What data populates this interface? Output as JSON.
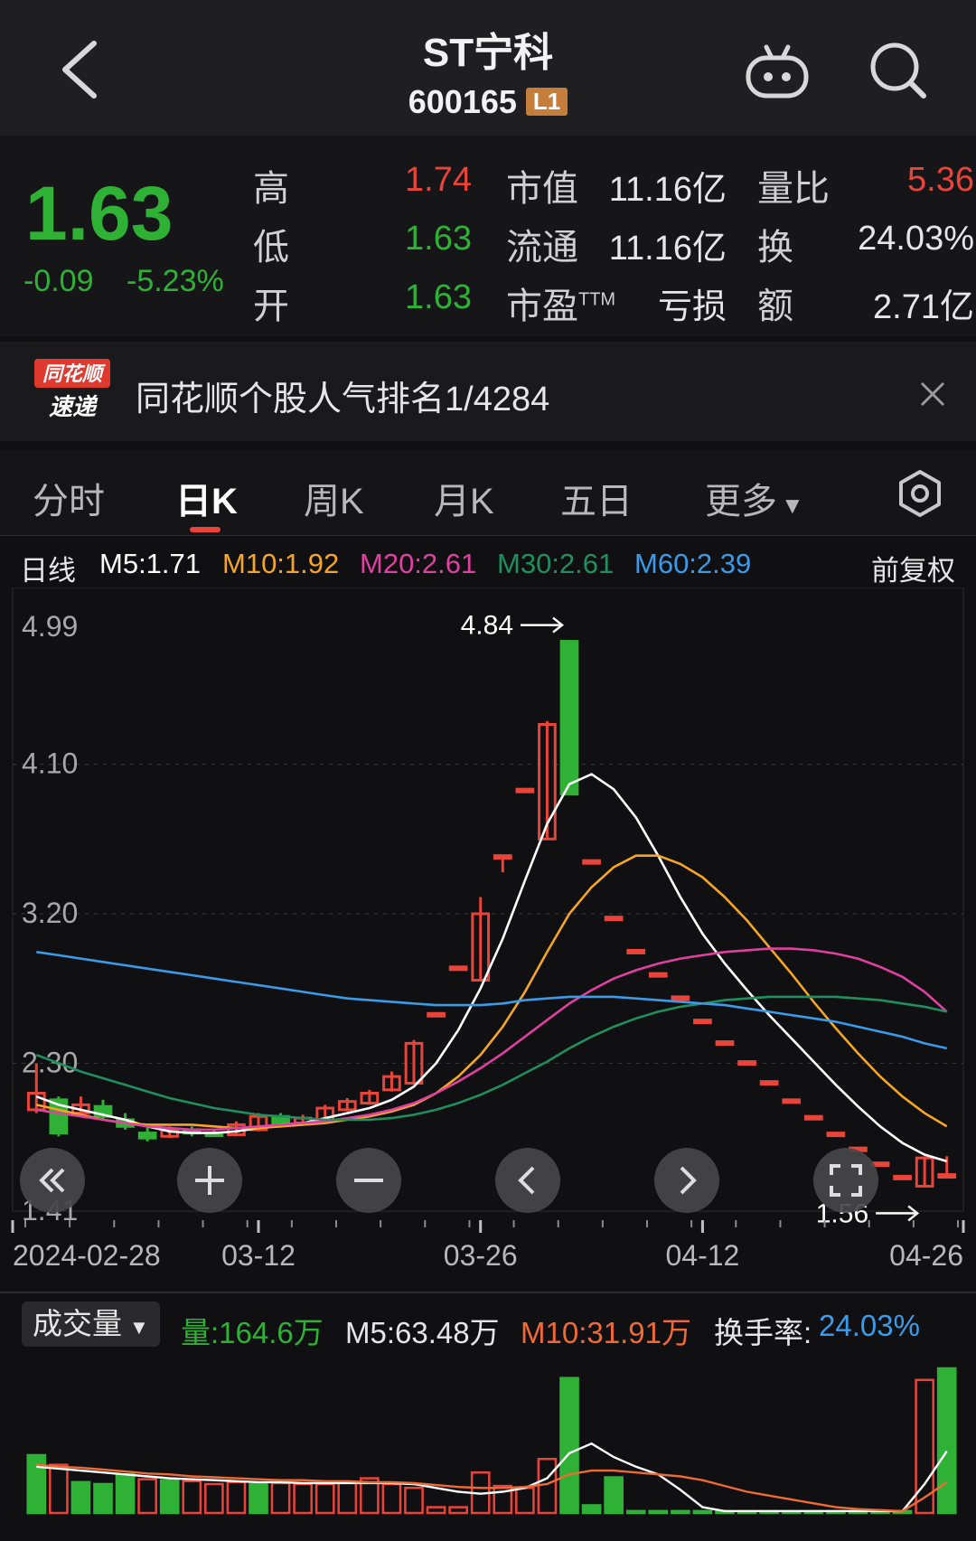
{
  "header": {
    "title": "ST宁科",
    "code": "600165",
    "level": "L1"
  },
  "quote": {
    "price": "1.63",
    "change": "-0.09",
    "change_pct": "-5.23%",
    "high_label": "高",
    "high": "1.74",
    "low_label": "低",
    "low": "1.63",
    "open_label": "开",
    "open": "1.63",
    "mcap_label": "市值",
    "mcap": "11.16亿",
    "float_label": "流通",
    "float": "11.16亿",
    "pe_label": "市盈",
    "pe_sup": "TTM",
    "pe": "亏损",
    "vol_ratio_label": "量比",
    "vol_ratio": "5.36",
    "turnover_label": "换",
    "turnover": "24.03%",
    "amount_label": "额",
    "amount": "2.71亿"
  },
  "banner": {
    "logo_top": "同花顺",
    "logo_bottom": "速递",
    "text": "同花顺个股人气排名1/4284"
  },
  "tabs": [
    "分时",
    "日K",
    "周K",
    "月K",
    "五日",
    "更多"
  ],
  "ma_legend": {
    "period": "日线",
    "m5": "M5:1.71",
    "m10": "M10:1.92",
    "m20": "M20:2.61",
    "m30": "M30:2.61",
    "m60": "M60:2.39",
    "adjust": "前复权",
    "colors": {
      "m5": "#ffffff",
      "m10": "#f5a623",
      "m20": "#e040a0",
      "m30": "#1f8f5f",
      "m60": "#3a9be8"
    }
  },
  "chart_data": {
    "type": "candlestick",
    "y_ticks": [
      "4.99",
      "4.10",
      "3.20",
      "2.30",
      "1.41"
    ],
    "ylim": [
      1.41,
      4.99
    ],
    "x_ticks": [
      "2024-02-28",
      "03-12",
      "03-26",
      "04-12",
      "04-26"
    ],
    "max_label": "4.84",
    "min_label": "1.56",
    "candles": [
      {
        "o": 2.02,
        "c": 2.12,
        "h": 2.3,
        "l": 2.0
      },
      {
        "o": 2.08,
        "c": 1.88,
        "h": 2.1,
        "l": 1.86
      },
      {
        "o": 2.0,
        "c": 2.05,
        "h": 2.1,
        "l": 1.98
      },
      {
        "o": 2.04,
        "c": 1.98,
        "h": 2.08,
        "l": 1.96
      },
      {
        "o": 1.96,
        "c": 1.92,
        "h": 2.0,
        "l": 1.9
      },
      {
        "o": 1.88,
        "c": 1.85,
        "h": 1.92,
        "l": 1.83
      },
      {
        "o": 1.86,
        "c": 1.9,
        "h": 1.92,
        "l": 1.85
      },
      {
        "o": 1.9,
        "c": 1.88,
        "h": 1.92,
        "l": 1.86
      },
      {
        "o": 1.88,
        "c": 1.87,
        "h": 1.9,
        "l": 1.86
      },
      {
        "o": 1.87,
        "c": 1.93,
        "h": 1.95,
        "l": 1.86
      },
      {
        "o": 1.9,
        "c": 1.98,
        "h": 2.0,
        "l": 1.89
      },
      {
        "o": 1.98,
        "c": 1.94,
        "h": 2.0,
        "l": 1.93
      },
      {
        "o": 1.94,
        "c": 1.97,
        "h": 1.99,
        "l": 1.93
      },
      {
        "o": 1.96,
        "c": 2.03,
        "h": 2.05,
        "l": 1.95
      },
      {
        "o": 2.02,
        "c": 2.07,
        "h": 2.09,
        "l": 2.01
      },
      {
        "o": 2.06,
        "c": 2.12,
        "h": 2.14,
        "l": 2.05
      },
      {
        "o": 2.14,
        "c": 2.22,
        "h": 2.25,
        "l": 2.13
      },
      {
        "o": 2.18,
        "c": 2.42,
        "h": 2.44,
        "l": 2.17
      },
      {
        "o": 2.6,
        "c": 2.6,
        "h": 2.6,
        "l": 2.6
      },
      {
        "o": 2.88,
        "c": 2.88,
        "h": 2.88,
        "l": 2.88
      },
      {
        "o": 2.8,
        "c": 3.2,
        "h": 3.3,
        "l": 2.8
      },
      {
        "o": 3.55,
        "c": 3.55,
        "h": 3.55,
        "l": 3.45
      },
      {
        "o": 3.95,
        "c": 3.95,
        "h": 3.95,
        "l": 3.95
      },
      {
        "o": 3.65,
        "c": 4.34,
        "h": 4.36,
        "l": 3.65
      },
      {
        "o": 4.84,
        "c": 3.92,
        "h": 4.84,
        "l": 3.92
      },
      {
        "o": 3.52,
        "c": 3.52,
        "h": 3.52,
        "l": 3.52
      },
      {
        "o": 3.18,
        "c": 3.18,
        "h": 3.18,
        "l": 3.18
      },
      {
        "o": 2.98,
        "c": 2.98,
        "h": 2.98,
        "l": 2.98
      },
      {
        "o": 2.84,
        "c": 2.84,
        "h": 2.84,
        "l": 2.84
      },
      {
        "o": 2.7,
        "c": 2.7,
        "h": 2.7,
        "l": 2.7
      },
      {
        "o": 2.56,
        "c": 2.56,
        "h": 2.56,
        "l": 2.56
      },
      {
        "o": 2.43,
        "c": 2.43,
        "h": 2.43,
        "l": 2.43
      },
      {
        "o": 2.31,
        "c": 2.31,
        "h": 2.31,
        "l": 2.31
      },
      {
        "o": 2.19,
        "c": 2.19,
        "h": 2.19,
        "l": 2.19
      },
      {
        "o": 2.08,
        "c": 2.08,
        "h": 2.08,
        "l": 2.08
      },
      {
        "o": 1.98,
        "c": 1.98,
        "h": 1.98,
        "l": 1.98
      },
      {
        "o": 1.88,
        "c": 1.88,
        "h": 1.88,
        "l": 1.88
      },
      {
        "o": 1.79,
        "c": 1.79,
        "h": 1.79,
        "l": 1.79
      },
      {
        "o": 1.7,
        "c": 1.7,
        "h": 1.7,
        "l": 1.7
      },
      {
        "o": 1.62,
        "c": 1.62,
        "h": 1.62,
        "l": 1.62
      },
      {
        "o": 1.56,
        "c": 1.73,
        "h": 1.74,
        "l": 1.56
      },
      {
        "o": 1.63,
        "c": 1.63,
        "h": 1.74,
        "l": 1.63
      }
    ],
    "ma_series": [
      {
        "name": "M5",
        "values": [
          2.1,
          2.05,
          2.02,
          1.99,
          1.96,
          1.92,
          1.89,
          1.88,
          1.88,
          1.89,
          1.91,
          1.93,
          1.94,
          1.97,
          2.0,
          2.03,
          2.08,
          2.16,
          2.3,
          2.5,
          2.75,
          3.05,
          3.4,
          3.74,
          3.98,
          4.04,
          3.95,
          3.78,
          3.55,
          3.3,
          3.08,
          2.9,
          2.74,
          2.59,
          2.45,
          2.31,
          2.17,
          2.04,
          1.92,
          1.82,
          1.75,
          1.71
        ]
      },
      {
        "name": "M10",
        "values": [
          2.05,
          2.02,
          1.99,
          1.96,
          1.94,
          1.93,
          1.93,
          1.93,
          1.92,
          1.91,
          1.91,
          1.92,
          1.93,
          1.94,
          1.96,
          1.98,
          2.01,
          2.05,
          2.12,
          2.22,
          2.35,
          2.52,
          2.73,
          2.97,
          3.2,
          3.36,
          3.48,
          3.55,
          3.55,
          3.5,
          3.42,
          3.3,
          3.16,
          3.0,
          2.84,
          2.67,
          2.51,
          2.36,
          2.22,
          2.1,
          2.0,
          1.92
        ]
      },
      {
        "name": "M20",
        "values": [
          2.02,
          2.0,
          1.98,
          1.96,
          1.94,
          1.92,
          1.91,
          1.9,
          1.9,
          1.91,
          1.92,
          1.93,
          1.94,
          1.95,
          1.97,
          1.99,
          2.02,
          2.06,
          2.12,
          2.19,
          2.27,
          2.36,
          2.46,
          2.56,
          2.66,
          2.74,
          2.81,
          2.86,
          2.9,
          2.93,
          2.95,
          2.97,
          2.98,
          2.99,
          2.99,
          2.98,
          2.96,
          2.93,
          2.88,
          2.82,
          2.73,
          2.61
        ]
      },
      {
        "name": "M30",
        "values": [
          2.35,
          2.3,
          2.25,
          2.21,
          2.17,
          2.13,
          2.09,
          2.06,
          2.03,
          2.01,
          1.99,
          1.98,
          1.97,
          1.96,
          1.96,
          1.96,
          1.97,
          1.99,
          2.02,
          2.06,
          2.11,
          2.17,
          2.24,
          2.31,
          2.39,
          2.46,
          2.52,
          2.57,
          2.61,
          2.64,
          2.66,
          2.68,
          2.69,
          2.7,
          2.7,
          2.7,
          2.7,
          2.69,
          2.68,
          2.66,
          2.64,
          2.61
        ]
      },
      {
        "name": "M60",
        "values": [
          2.97,
          2.95,
          2.93,
          2.91,
          2.89,
          2.87,
          2.85,
          2.83,
          2.81,
          2.79,
          2.77,
          2.75,
          2.73,
          2.71,
          2.69,
          2.68,
          2.67,
          2.66,
          2.65,
          2.65,
          2.65,
          2.66,
          2.68,
          2.69,
          2.7,
          2.7,
          2.7,
          2.69,
          2.68,
          2.67,
          2.66,
          2.65,
          2.63,
          2.61,
          2.59,
          2.57,
          2.55,
          2.52,
          2.49,
          2.46,
          2.42,
          2.39
        ]
      }
    ]
  },
  "volume": {
    "select_label": "成交量",
    "vol": "量:164.6万",
    "m5": "M5:63.48万",
    "m10": "M10:31.91万",
    "turnover_label": "换手率:",
    "turnover": "24.03%",
    "bars": [
      {
        "v": 60,
        "up": false
      },
      {
        "v": 50,
        "up": true
      },
      {
        "v": 32,
        "up": false
      },
      {
        "v": 30,
        "up": false
      },
      {
        "v": 40,
        "up": false
      },
      {
        "v": 35,
        "up": true
      },
      {
        "v": 34,
        "up": false
      },
      {
        "v": 33,
        "up": true
      },
      {
        "v": 30,
        "up": true
      },
      {
        "v": 32,
        "up": true
      },
      {
        "v": 30,
        "up": false
      },
      {
        "v": 31,
        "up": true
      },
      {
        "v": 30,
        "up": true
      },
      {
        "v": 30,
        "up": true
      },
      {
        "v": 32,
        "up": true
      },
      {
        "v": 36,
        "up": true
      },
      {
        "v": 30,
        "up": true
      },
      {
        "v": 26,
        "up": true
      },
      {
        "v": 6,
        "up": true
      },
      {
        "v": 6,
        "up": true
      },
      {
        "v": 42,
        "up": true
      },
      {
        "v": 28,
        "up": true
      },
      {
        "v": 26,
        "up": true
      },
      {
        "v": 56,
        "up": true
      },
      {
        "v": 140,
        "up": false
      },
      {
        "v": 8,
        "up": false
      },
      {
        "v": 37,
        "up": false
      },
      {
        "v": 2,
        "up": false
      },
      {
        "v": 2,
        "up": false
      },
      {
        "v": 2,
        "up": false
      },
      {
        "v": 2,
        "up": false
      },
      {
        "v": 2,
        "up": false
      },
      {
        "v": 2,
        "up": false
      },
      {
        "v": 2,
        "up": false
      },
      {
        "v": 2,
        "up": false
      },
      {
        "v": 2,
        "up": false
      },
      {
        "v": 2,
        "up": false
      },
      {
        "v": 2,
        "up": false
      },
      {
        "v": 2,
        "up": false
      },
      {
        "v": 2,
        "up": false
      },
      {
        "v": 138,
        "up": true
      },
      {
        "v": 150,
        "up": false
      }
    ],
    "ma5": [
      48,
      46,
      44,
      42,
      40,
      38,
      36,
      35,
      34,
      33,
      32,
      32,
      31,
      31,
      31,
      31,
      31,
      30,
      26,
      22,
      20,
      22,
      26,
      36,
      62,
      72,
      58,
      48,
      40,
      24,
      6,
      2,
      2,
      2,
      2,
      2,
      2,
      2,
      2,
      2,
      30,
      64
    ],
    "ma10": [
      50,
      48,
      47,
      45,
      43,
      41,
      40,
      38,
      37,
      36,
      35,
      34,
      34,
      33,
      33,
      32,
      32,
      31,
      29,
      27,
      26,
      26,
      27,
      30,
      40,
      44,
      44,
      42,
      40,
      38,
      34,
      28,
      22,
      18,
      14,
      10,
      6,
      4,
      3,
      2,
      16,
      32
    ]
  },
  "zoom_controls": [
    "fast-rewind",
    "zoom-in",
    "zoom-out",
    "prev",
    "next",
    "fullscreen"
  ]
}
